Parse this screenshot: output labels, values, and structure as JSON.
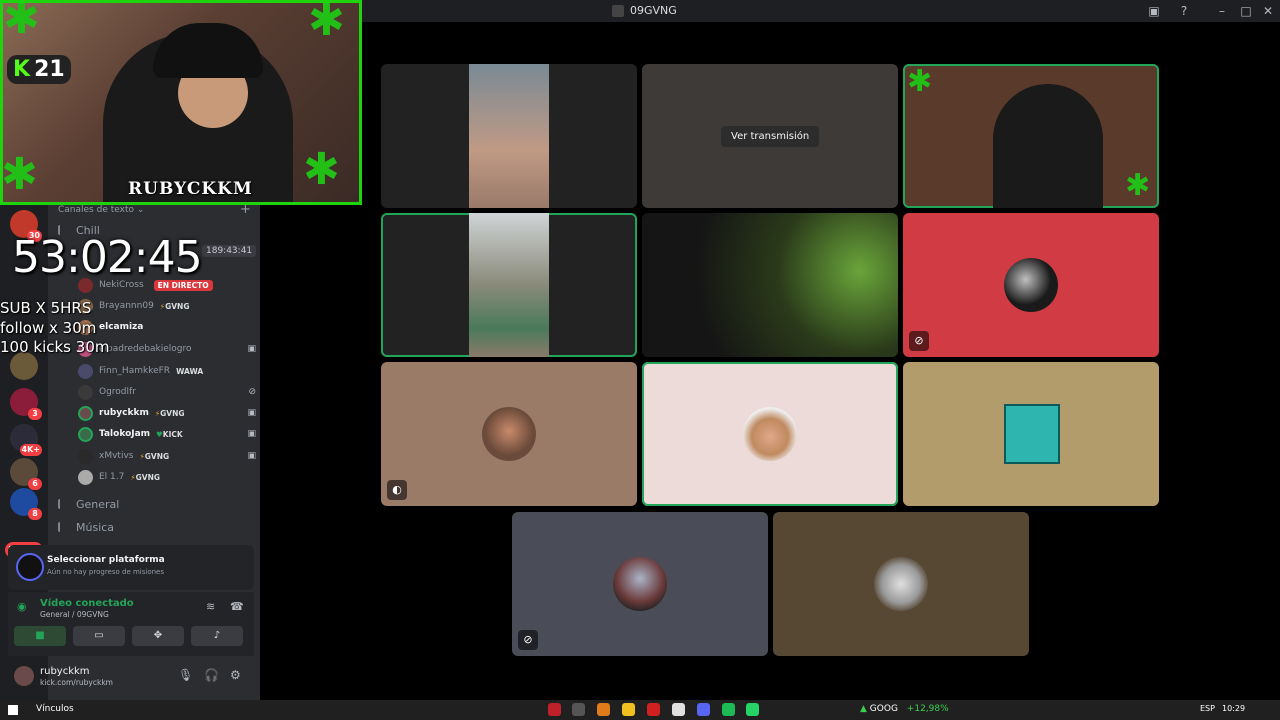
{
  "window": {
    "title": "09GVNG"
  },
  "overlay": {
    "kick_count": "21",
    "cam_name": "RUBYCKKM",
    "timer": "53:02:45",
    "lines": [
      "SUB X 5HRS",
      "follow x 30m",
      "100 kicks 30m"
    ]
  },
  "rail": {
    "badges": [
      "30",
      "3",
      "4K+",
      "6",
      "8"
    ],
    "new_label": "NUEVO"
  },
  "channels": {
    "category": "Canales de texto",
    "chill": "Chill",
    "chill_timer": "189:43:41",
    "general": "General",
    "musica": "Música",
    "live_label": "EN DIRECTO",
    "users": [
      {
        "name": "NekiCross",
        "tag": "",
        "icons": ""
      },
      {
        "name": "Brayannn09",
        "tag": "GVNG",
        "icons": ""
      },
      {
        "name": "elcamiza",
        "tag": "",
        "icons": ""
      },
      {
        "name": "elpadredebakielogro",
        "tag": "",
        "icons": "▣"
      },
      {
        "name": "Finn_HamkkeFR",
        "tag": "WAWA",
        "icons": ""
      },
      {
        "name": "Ogrodlfr",
        "tag": "",
        "icons": ""
      },
      {
        "name": "rubyckkm",
        "tag": "GVNG",
        "icons": "▣"
      },
      {
        "name": "TalokoJam",
        "tag": "KICK",
        "icons": "▣"
      },
      {
        "name": "xMvtivs",
        "tag": "GVNG",
        "icons": "▣"
      },
      {
        "name": "El 1.7",
        "tag": "GVNG",
        "icons": ""
      }
    ]
  },
  "mission": {
    "title": "Seleccionar plataforma",
    "subtitle": "Aún no hay progreso de misiones"
  },
  "voice": {
    "status": "Vídeo conectado",
    "location": "General / 09GVNG"
  },
  "me": {
    "name": "rubyckkm",
    "status": "kick.com/rubyckkm"
  },
  "stage": {
    "watch_label": "Ver transmisión"
  },
  "taskbar": {
    "links": "Vínculos",
    "ticker": "GOOG",
    "change": "+12,98%",
    "lang": "ESP",
    "time": "10:29"
  },
  "colors": {
    "accent_green": "#23a559",
    "live_red": "#da373c",
    "kick_green": "#53fc18"
  }
}
